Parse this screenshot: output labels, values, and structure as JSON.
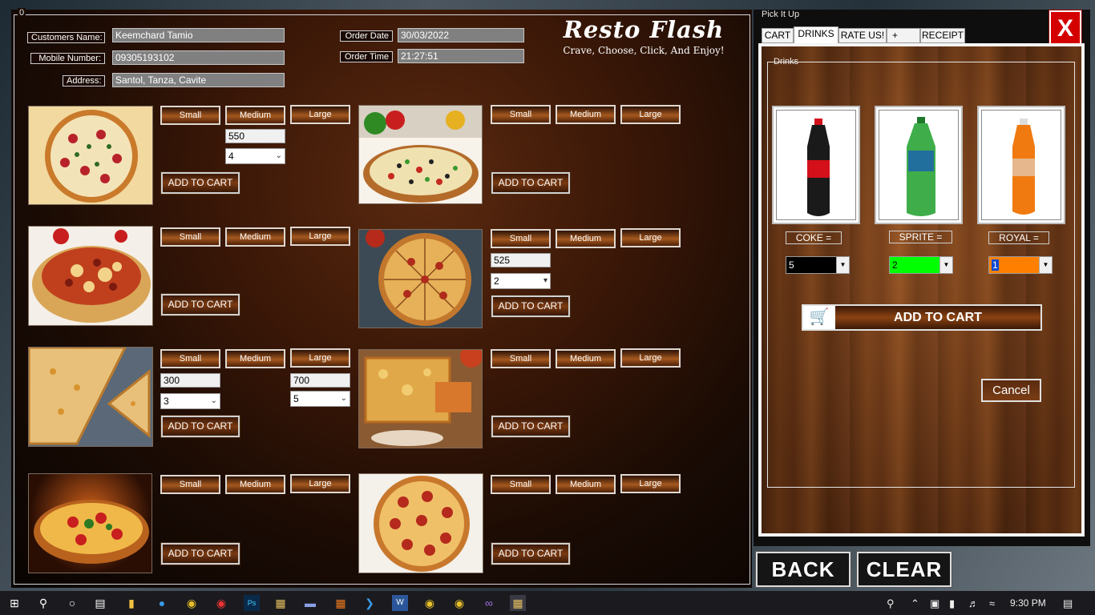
{
  "left_panel": {
    "legend": "0",
    "customer": {
      "name_label": "Customers Name:",
      "name_value": "Keemchard Tamio",
      "mobile_label": "Mobile Number:",
      "mobile_value": "09305193102",
      "address_label": "Address:",
      "address_value": "Santol, Tanza, Cavite",
      "order_date_label": "Order Date",
      "order_date_value": "30/03/2022",
      "order_time_label": "Order Time",
      "order_time_value": "21:27:51"
    },
    "brand": {
      "name": "Resto Flash",
      "tagline": "Crave, Choose, Click, And Enjoy!"
    },
    "size_labels": {
      "small": "Small",
      "medium": "Medium",
      "large": "Large"
    },
    "add_to_cart_label": "ADD TO CART",
    "pizzas": [
      {
        "price": "550",
        "qty": "4"
      },
      {
        "price": "",
        "qty": ""
      },
      {
        "price": "",
        "qty": ""
      },
      {
        "price": "525",
        "qty": "2"
      },
      {
        "price": "300",
        "qty": "3",
        "price_large": "700",
        "qty_large": "5"
      },
      {
        "price": "",
        "qty": ""
      },
      {
        "price": "",
        "qty": ""
      },
      {
        "price": "",
        "qty": ""
      }
    ]
  },
  "right_panel": {
    "legend": "Pick It Up",
    "close_label": "X",
    "tabs": [
      "CART",
      "DRINKS",
      "RATE US!",
      "+",
      "RECEIPT"
    ],
    "active_tab": "DRINKS",
    "drinks_group_label": "Drinks",
    "drinks": [
      {
        "label": "COKE  =",
        "qty": "5",
        "color": "#000000",
        "bottle_color": "#1a1a1a",
        "label_band": "#d4101a"
      },
      {
        "label": "SPRITE  =",
        "qty": "2",
        "color": "#00ff00",
        "bottle_color": "#3fae4a",
        "label_band": "#1a5fb0"
      },
      {
        "label": "ROYAL  =",
        "qty": "1",
        "color": "#ff8000",
        "bottle_color": "#f07a10",
        "label_band": "#e0e0e0"
      }
    ],
    "drinks_add_label": "ADD TO CART",
    "cancel_label": "Cancel"
  },
  "bottom_buttons": {
    "back": "BACK",
    "clear": "CLEAR"
  },
  "taskbar": {
    "clock": "9:30 PM"
  }
}
